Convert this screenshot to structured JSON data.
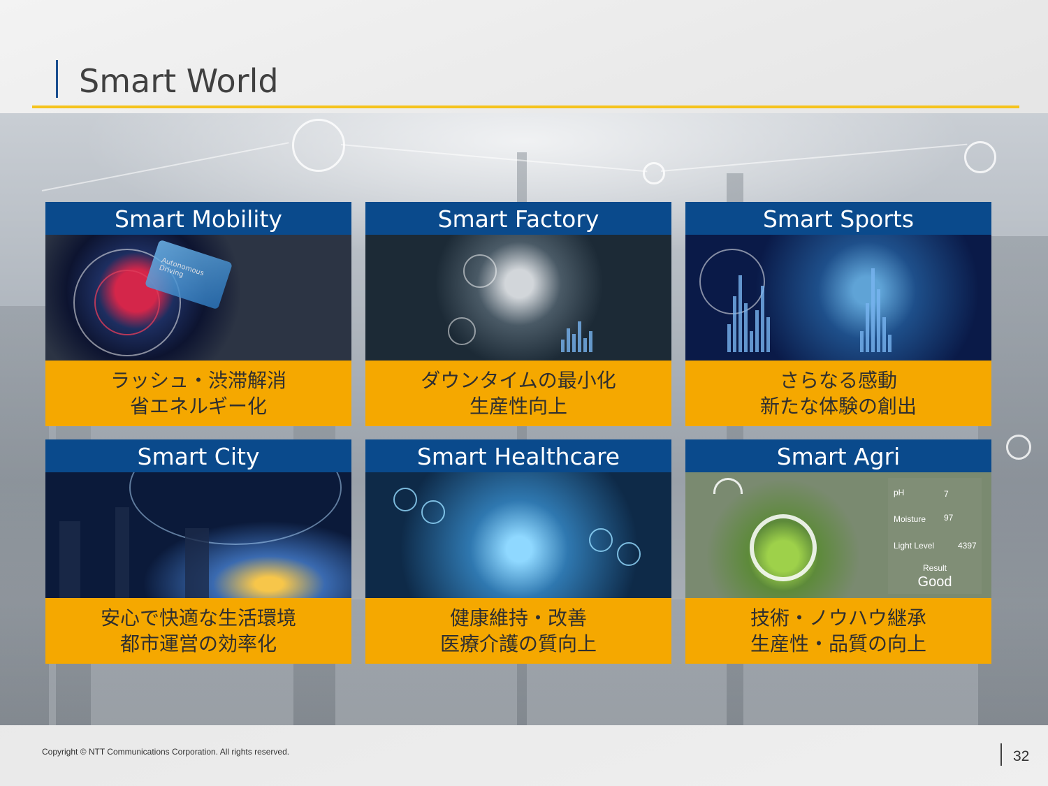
{
  "slide": {
    "title": "Smart World",
    "copyright": "Copyright © NTT Communications Corporation. All rights reserved.",
    "page_number": "32"
  },
  "colors": {
    "header_blue": "#0a4a8c",
    "caption_orange": "#f5a800",
    "title_rule": "#f5c31c"
  },
  "cards": [
    {
      "title": "Smart Mobility",
      "caption_line1": "ラッシュ・渋滞解消",
      "caption_line2": "省エネルギー化",
      "image_text": "Autonomous Driving"
    },
    {
      "title": "Smart Factory",
      "caption_line1": "ダウンタイムの最小化",
      "caption_line2": "生産性向上"
    },
    {
      "title": "Smart Sports",
      "caption_line1": "さらなる感動",
      "caption_line2": "新たな体験の創出"
    },
    {
      "title": "Smart City",
      "caption_line1": "安心で快適な生活環境",
      "caption_line2": "都市運営の効率化"
    },
    {
      "title": "Smart Healthcare",
      "caption_line1": "健康維持・改善",
      "caption_line2": "医療介護の質向上"
    },
    {
      "title": "Smart Agri",
      "caption_line1": "技術・ノウハウ継承",
      "caption_line2": "生産性・品質の向上",
      "sensor": {
        "ph_label": "pH",
        "ph_value": "7",
        "moisture_label": "Moisture",
        "moisture_value": "97",
        "light_label": "Light Level",
        "light_value": "4397",
        "result_label": "Result",
        "result_value": "Good"
      }
    }
  ]
}
